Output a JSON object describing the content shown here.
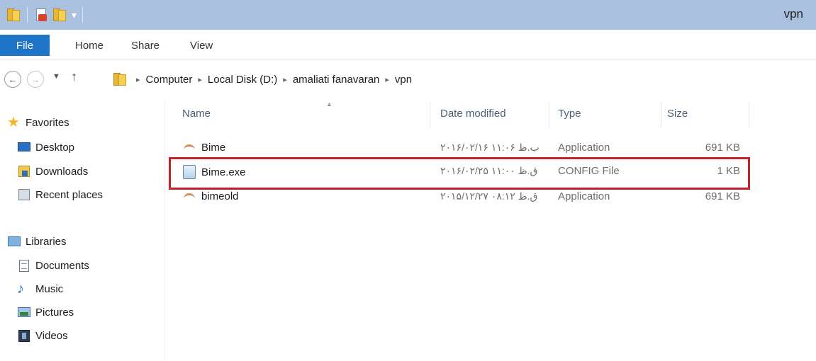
{
  "window": {
    "title": "vpn"
  },
  "ribbon": {
    "tabs": [
      {
        "label": "File"
      },
      {
        "label": "Home"
      },
      {
        "label": "Share"
      },
      {
        "label": "View"
      }
    ]
  },
  "address": {
    "separator": "▸",
    "crumbs": [
      "Computer",
      "Local Disk (D:)",
      "amaliati fanavaran",
      "vpn"
    ]
  },
  "nav_pane": {
    "favorites": {
      "label": "Favorites",
      "items": [
        {
          "label": "Desktop",
          "icon": "desktop-icon"
        },
        {
          "label": "Downloads",
          "icon": "downloads-icon"
        },
        {
          "label": "Recent places",
          "icon": "recent-places-icon"
        }
      ]
    },
    "libraries": {
      "label": "Libraries",
      "items": [
        {
          "label": "Documents",
          "icon": "documents-icon"
        },
        {
          "label": "Music",
          "icon": "music-icon"
        },
        {
          "label": "Pictures",
          "icon": "pictures-icon"
        },
        {
          "label": "Videos",
          "icon": "videos-icon"
        }
      ]
    }
  },
  "file_list": {
    "columns": [
      "Name",
      "Date modified",
      "Type",
      "Size"
    ],
    "rows": [
      {
        "name": "Bime",
        "date": "۲۰۱۶/۰۲/۱۶ ب.ظ ۱۱:۰۶",
        "type": "Application",
        "size": "691 KB",
        "icon": "application-icon"
      },
      {
        "name": "Bime.exe",
        "date": "۲۰۱۶/۰۲/۲۵ ق.ظ ۱۱:۰۰",
        "type": "CONFIG File",
        "size": "1 KB",
        "icon": "config-file-icon"
      },
      {
        "name": "bimeold",
        "date": "۲۰۱۵/۱۲/۲۷ ق.ظ ۰۸:۱۲",
        "type": "Application",
        "size": "691 KB",
        "icon": "application-icon"
      }
    ]
  },
  "colors": {
    "titlebar": "#a9c1de",
    "file_tab": "#1e74c6",
    "highlight": "#c4202a"
  }
}
